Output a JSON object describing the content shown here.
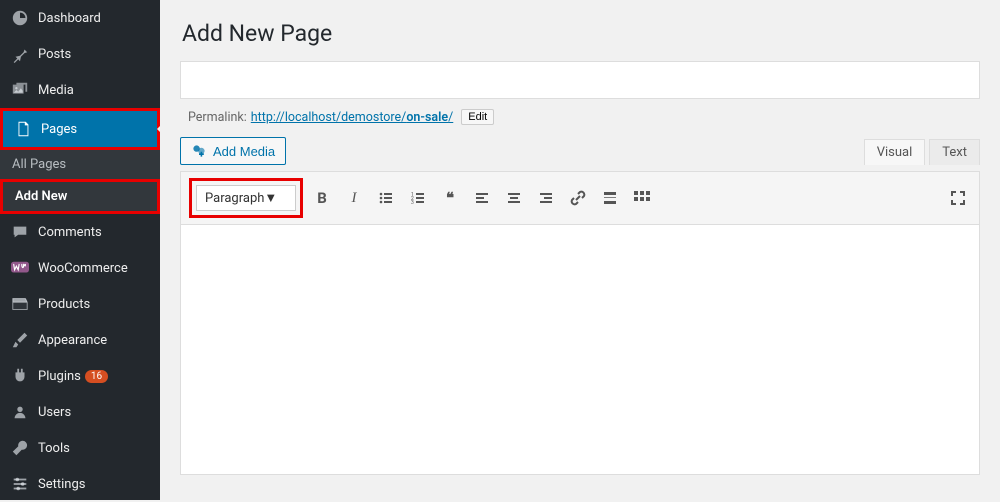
{
  "sidebar": {
    "items": [
      {
        "label": "Dashboard"
      },
      {
        "label": "Posts"
      },
      {
        "label": "Media"
      },
      {
        "label": "Pages"
      },
      {
        "label": "Comments"
      },
      {
        "label": "WooCommerce"
      },
      {
        "label": "Products"
      },
      {
        "label": "Appearance"
      },
      {
        "label": "Plugins",
        "badge": "16"
      },
      {
        "label": "Users"
      },
      {
        "label": "Tools"
      },
      {
        "label": "Settings"
      }
    ],
    "sub": {
      "all_pages": "All Pages",
      "add_new": "Add New"
    }
  },
  "page": {
    "title": "Add New Page",
    "permalink_label": "Permalink:",
    "permalink_base": "http://localhost/demostore/",
    "permalink_slug": "on-sale",
    "permalink_trail": "/",
    "edit_label": "Edit",
    "add_media_label": "Add Media"
  },
  "editor": {
    "tabs": {
      "visual": "Visual",
      "text": "Text"
    },
    "format_selected": "Paragraph"
  }
}
